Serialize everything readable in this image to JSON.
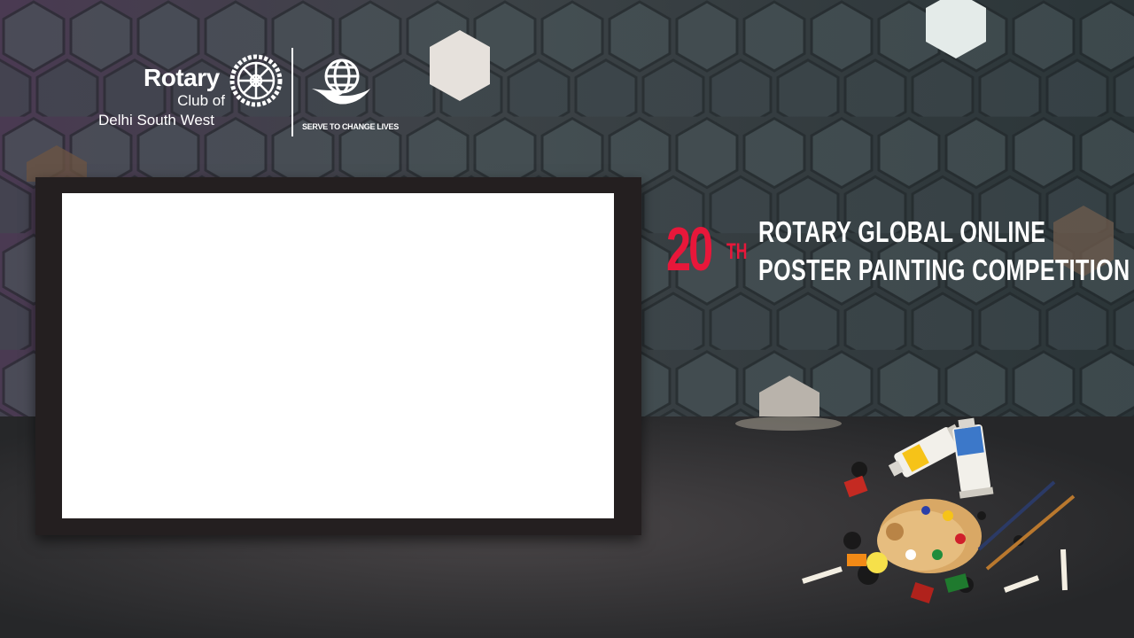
{
  "logo": {
    "brand": "Rotary",
    "club_of": "Club of",
    "club_name": "Delhi South West",
    "tagline": "SERVE TO CHANGE LIVES"
  },
  "title": {
    "number": "20",
    "ordinal": "TH",
    "line1": "ROTARY GLOBAL ONLINE",
    "line2": "POSTER PAINTING COMPETITION"
  },
  "colors": {
    "accent_red": "#e8173a",
    "frame": "#241f20",
    "text": "#ffffff"
  },
  "icons": {
    "rotary_wheel": "rotary-wheel-icon",
    "globe_hand": "globe-hand-icon",
    "art_supplies": "paint-palette-icon"
  }
}
